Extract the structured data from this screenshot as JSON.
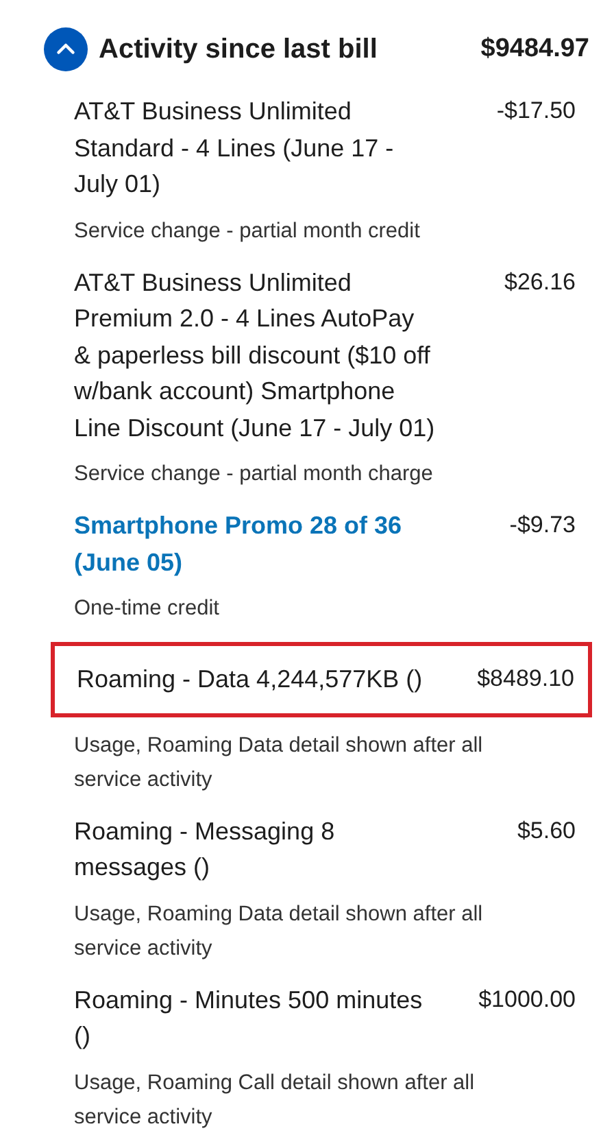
{
  "header": {
    "title": "Activity since last bill",
    "amount": "$9484.97",
    "expanded": true
  },
  "items": [
    {
      "title": "AT&T Business Unlimited Standard - 4 Lines (June 17 - July 01)",
      "amount": "-$17.50",
      "note": "Service change - partial month credit",
      "kind": "plain",
      "highlighted": false
    },
    {
      "title": "AT&T Business Unlimited Premium 2.0 - 4 Lines AutoPay & paperless bill discount ($10 off w/bank account) Smartphone Line Discount (June 17 - July 01)",
      "amount": "$26.16",
      "note": "Service change - partial month charge",
      "kind": "plain",
      "highlighted": false
    },
    {
      "title": "Smartphone Promo 28 of 36 (June 05)",
      "amount": "-$9.73",
      "note": "One-time credit",
      "kind": "link",
      "highlighted": false
    },
    {
      "title": "Roaming - Data 4,244,577KB ()",
      "amount": "$8489.10",
      "note": "Usage, Roaming Data detail shown after all service activity",
      "kind": "plain",
      "highlighted": true
    },
    {
      "title": "Roaming - Messaging 8 messages ()",
      "amount": "$5.60",
      "note": "Usage, Roaming Data detail shown after all service activity",
      "kind": "plain",
      "highlighted": false
    },
    {
      "title": "Roaming - Minutes 500 minutes ()",
      "amount": "$1000.00",
      "note": "Usage, Roaming Call detail shown after all service activity",
      "kind": "plain",
      "highlighted": false
    }
  ]
}
